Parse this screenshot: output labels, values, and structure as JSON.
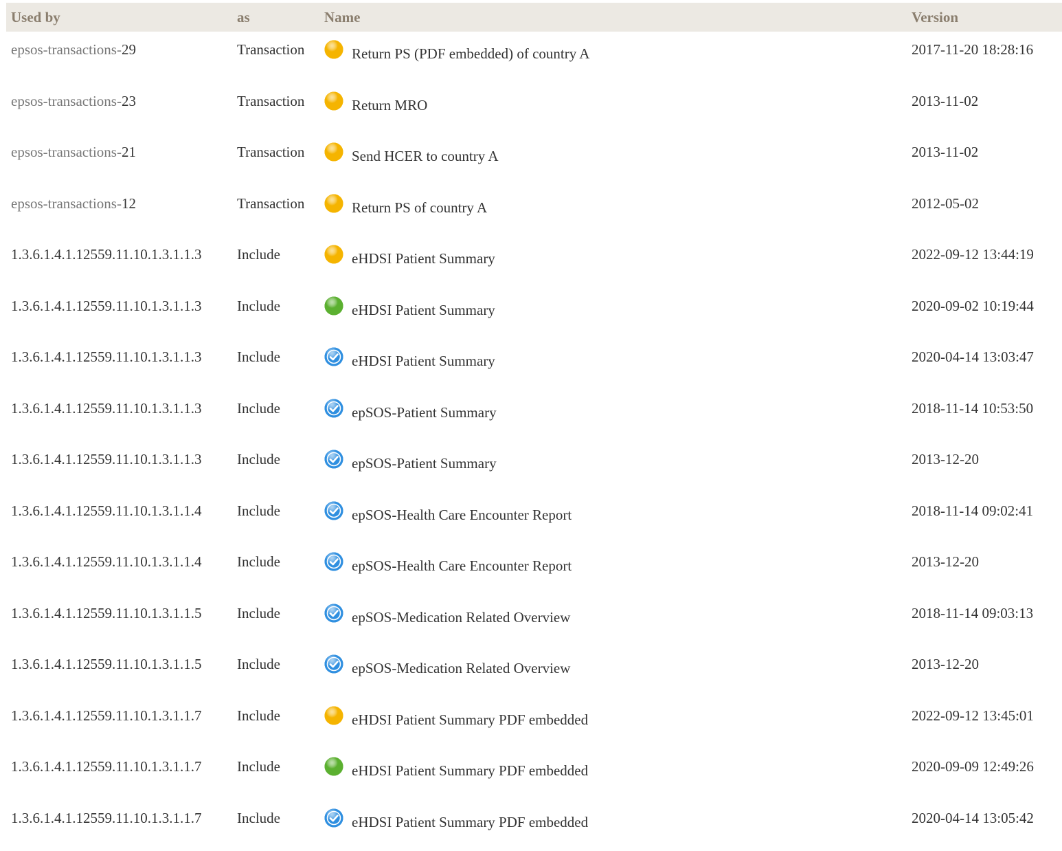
{
  "table": {
    "headers": {
      "used_by": "Used by",
      "as": "as",
      "name": "Name",
      "version": "Version"
    },
    "rows": [
      {
        "used_prefix": "epsos-transactions-",
        "used_num": "29",
        "as": "Transaction",
        "status": "draft",
        "name": "Return PS (PDF embedded) of country A",
        "version": "2017-11-20 18:28:16"
      },
      {
        "used_prefix": "epsos-transactions-",
        "used_num": "23",
        "as": "Transaction",
        "status": "draft",
        "name": "Return MRO",
        "version": "2013-11-02"
      },
      {
        "used_prefix": "epsos-transactions-",
        "used_num": "21",
        "as": "Transaction",
        "status": "draft",
        "name": "Send HCER to country A",
        "version": "2013-11-02"
      },
      {
        "used_prefix": "epsos-transactions-",
        "used_num": "12",
        "as": "Transaction",
        "status": "draft",
        "name": "Return PS of country A",
        "version": "2012-05-02"
      },
      {
        "used_prefix": "",
        "used_num": "1.3.6.1.4.1.12559.11.10.1.3.1.1.3",
        "as": "Include",
        "status": "draft",
        "name": "eHDSI Patient Summary",
        "version": "2022-09-12 13:44:19"
      },
      {
        "used_prefix": "",
        "used_num": "1.3.6.1.4.1.12559.11.10.1.3.1.1.3",
        "as": "Include",
        "status": "active",
        "name": "eHDSI Patient Summary",
        "version": "2020-09-02 10:19:44"
      },
      {
        "used_prefix": "",
        "used_num": "1.3.6.1.4.1.12559.11.10.1.3.1.1.3",
        "as": "Include",
        "status": "final",
        "name": "eHDSI Patient Summary",
        "version": "2020-04-14 13:03:47"
      },
      {
        "used_prefix": "",
        "used_num": "1.3.6.1.4.1.12559.11.10.1.3.1.1.3",
        "as": "Include",
        "status": "final",
        "name": "epSOS-Patient Summary",
        "version": "2018-11-14 10:53:50"
      },
      {
        "used_prefix": "",
        "used_num": "1.3.6.1.4.1.12559.11.10.1.3.1.1.3",
        "as": "Include",
        "status": "final",
        "name": "epSOS-Patient Summary",
        "version": "2013-12-20"
      },
      {
        "used_prefix": "",
        "used_num": "1.3.6.1.4.1.12559.11.10.1.3.1.1.4",
        "as": "Include",
        "status": "final",
        "name": "epSOS-Health Care Encounter Report",
        "version": "2018-11-14 09:02:41"
      },
      {
        "used_prefix": "",
        "used_num": "1.3.6.1.4.1.12559.11.10.1.3.1.1.4",
        "as": "Include",
        "status": "final",
        "name": "epSOS-Health Care Encounter Report",
        "version": "2013-12-20"
      },
      {
        "used_prefix": "",
        "used_num": "1.3.6.1.4.1.12559.11.10.1.3.1.1.5",
        "as": "Include",
        "status": "final",
        "name": "epSOS-Medication Related Overview",
        "version": "2018-11-14 09:03:13"
      },
      {
        "used_prefix": "",
        "used_num": "1.3.6.1.4.1.12559.11.10.1.3.1.1.5",
        "as": "Include",
        "status": "final",
        "name": "epSOS-Medication Related Overview",
        "version": "2013-12-20"
      },
      {
        "used_prefix": "",
        "used_num": "1.3.6.1.4.1.12559.11.10.1.3.1.1.7",
        "as": "Include",
        "status": "draft",
        "name": "eHDSI Patient Summary PDF embedded",
        "version": "2022-09-12 13:45:01"
      },
      {
        "used_prefix": "",
        "used_num": "1.3.6.1.4.1.12559.11.10.1.3.1.1.7",
        "as": "Include",
        "status": "active",
        "name": "eHDSI Patient Summary PDF embedded",
        "version": "2020-09-09 12:49:26"
      },
      {
        "used_prefix": "",
        "used_num": "1.3.6.1.4.1.12559.11.10.1.3.1.1.7",
        "as": "Include",
        "status": "final",
        "name": "eHDSI Patient Summary PDF embedded",
        "version": "2020-04-14 13:05:42"
      }
    ]
  },
  "status_icons": {
    "draft": {
      "icon": "orange-circle-icon",
      "color": "#f5b400"
    },
    "active": {
      "icon": "green-circle-icon",
      "color": "#5bb030"
    },
    "final": {
      "icon": "blue-check-circle-icon",
      "color": "#2f8fe0"
    }
  },
  "colors": {
    "header_bg": "#ece9e3",
    "header_text": "#8a7e6e",
    "prefix_text": "#777777",
    "body_text": "#333333"
  }
}
